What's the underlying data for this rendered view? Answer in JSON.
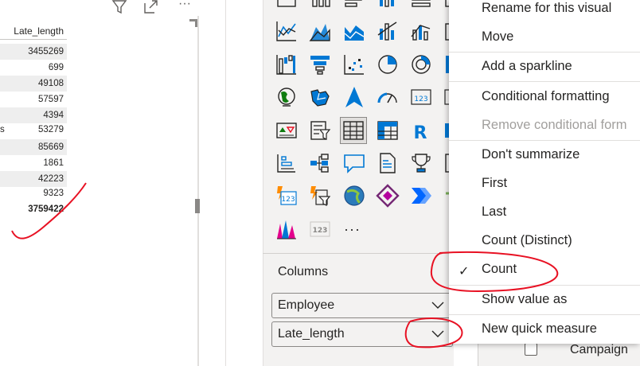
{
  "table": {
    "column_header": "Late_length",
    "rows": [
      {
        "label": "",
        "value": "3455269"
      },
      {
        "label": "",
        "value": "699"
      },
      {
        "label": "",
        "value": "49108"
      },
      {
        "label": "",
        "value": "57597"
      },
      {
        "label": "",
        "value": "4394"
      },
      {
        "label": "s",
        "value": "53279"
      },
      {
        "label": "",
        "value": "85669"
      },
      {
        "label": "",
        "value": "1861"
      },
      {
        "label": "",
        "value": "42223"
      },
      {
        "label": "",
        "value": "9323"
      }
    ],
    "total": "3759422"
  },
  "visual_header_icons": [
    "filter-icon",
    "focus-mode-icon",
    "more-options-icon"
  ],
  "more_options_glyph": "···",
  "viz_pane": {
    "more_visuals_glyph": "···",
    "r_visual_glyph": "R",
    "card_glyph": "123",
    "columns_label": "Columns",
    "fields": [
      {
        "name": "Employee"
      },
      {
        "name": "Late_length"
      }
    ]
  },
  "context_menu": {
    "items": [
      {
        "label": "Rename for this visual",
        "enabled": true,
        "checked": false
      },
      {
        "label": "Move",
        "enabled": true,
        "checked": false
      },
      {
        "label": "Add a sparkline",
        "enabled": true,
        "checked": false
      },
      {
        "label": "Conditional formatting",
        "enabled": true,
        "checked": false
      },
      {
        "label": "Remove conditional form",
        "enabled": false,
        "checked": false
      },
      {
        "label": "Don't summarize",
        "enabled": true,
        "checked": false
      },
      {
        "label": "First",
        "enabled": true,
        "checked": false
      },
      {
        "label": "Last",
        "enabled": true,
        "checked": false
      },
      {
        "label": "Count (Distinct)",
        "enabled": true,
        "checked": false
      },
      {
        "label": "Count",
        "enabled": true,
        "checked": true
      },
      {
        "label": "Show value as",
        "enabled": true,
        "checked": false
      },
      {
        "label": "New quick measure",
        "enabled": true,
        "checked": false
      }
    ],
    "check_glyph": "✓"
  },
  "fields_list": {
    "partial_item": "Campaign"
  },
  "colors": {
    "accent": "#0078d4",
    "pane_background": "#f3f2f1",
    "annotation_red": "#e81123",
    "disabled_text": "#a19f9d"
  }
}
